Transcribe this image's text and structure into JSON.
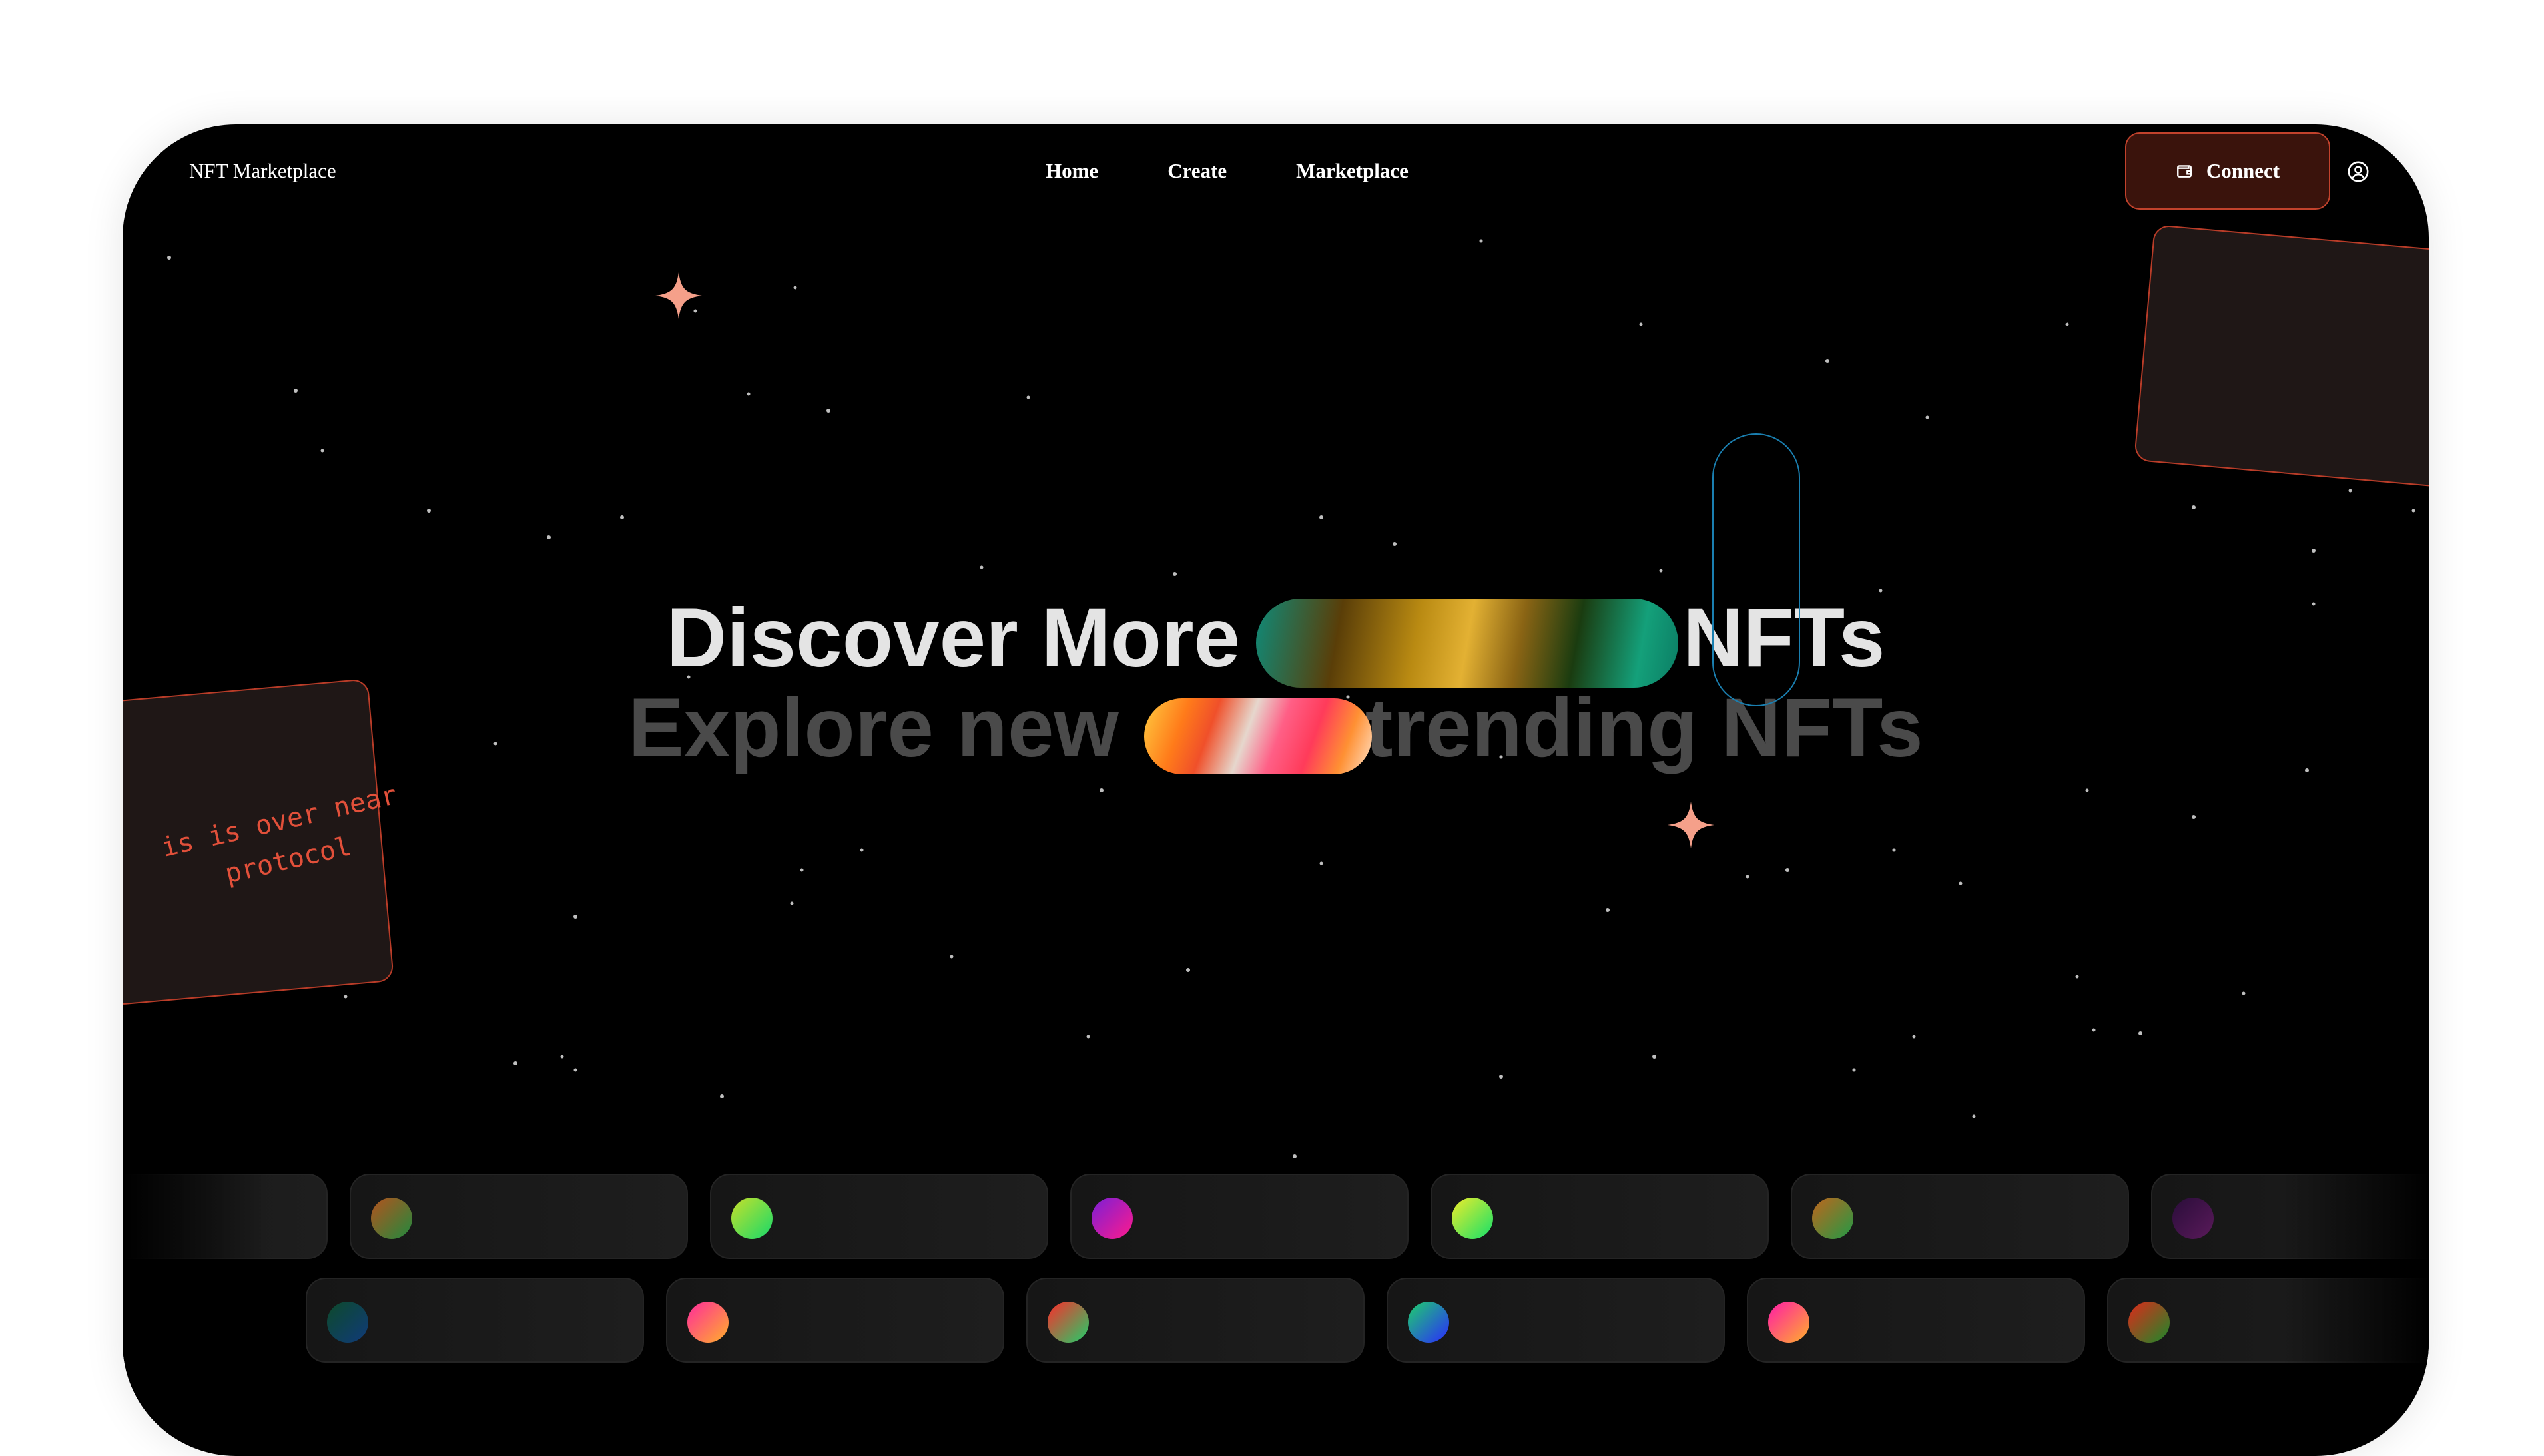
{
  "nav": {
    "brand": "NFT Marketplace",
    "links": [
      "Home",
      "Create",
      "Marketplace"
    ],
    "connect_label": "Connect",
    "connect_icon": "wallet-icon",
    "user_icon": "user-circle-icon"
  },
  "hero": {
    "line1_start": "Discover More",
    "line1_end": "NFTs",
    "line2_start": "Explore new",
    "line2_end": "trending NFTs"
  },
  "card_left_text": "is is over near\nprotocol",
  "colors": {
    "accent": "#c2422c",
    "connect_bg": "#3a130c",
    "sparkle": "#f5a08a",
    "outline_pill": "#1a7fb0",
    "heading_bright": "#e4e4e4",
    "heading_dim": "#4a4a4a"
  },
  "marquee": {
    "row1_dots": [
      [
        "#3a0d3a",
        "#5a1a5a"
      ],
      [
        "#b5521d",
        "#1f8a3e"
      ],
      [
        "#c7e02a",
        "#16d96a"
      ],
      [
        "#7a1fd6",
        "#ff1a8c"
      ],
      [
        "#f0ec2a",
        "#12e06a"
      ],
      [
        "#c0651c",
        "#209a46"
      ],
      [
        "#2a0d3a",
        "#5a1a5a"
      ]
    ],
    "row2_dots": [
      [
        "#0d4a2a",
        "#103a7a"
      ],
      [
        "#ff2a9c",
        "#ffb02a"
      ],
      [
        "#ff2a2a",
        "#1ed06a"
      ],
      [
        "#1ed06a",
        "#2a2aff"
      ],
      [
        "#ff1aa8",
        "#ffb02a"
      ],
      [
        "#e0281a",
        "#1a8a2a"
      ]
    ]
  }
}
